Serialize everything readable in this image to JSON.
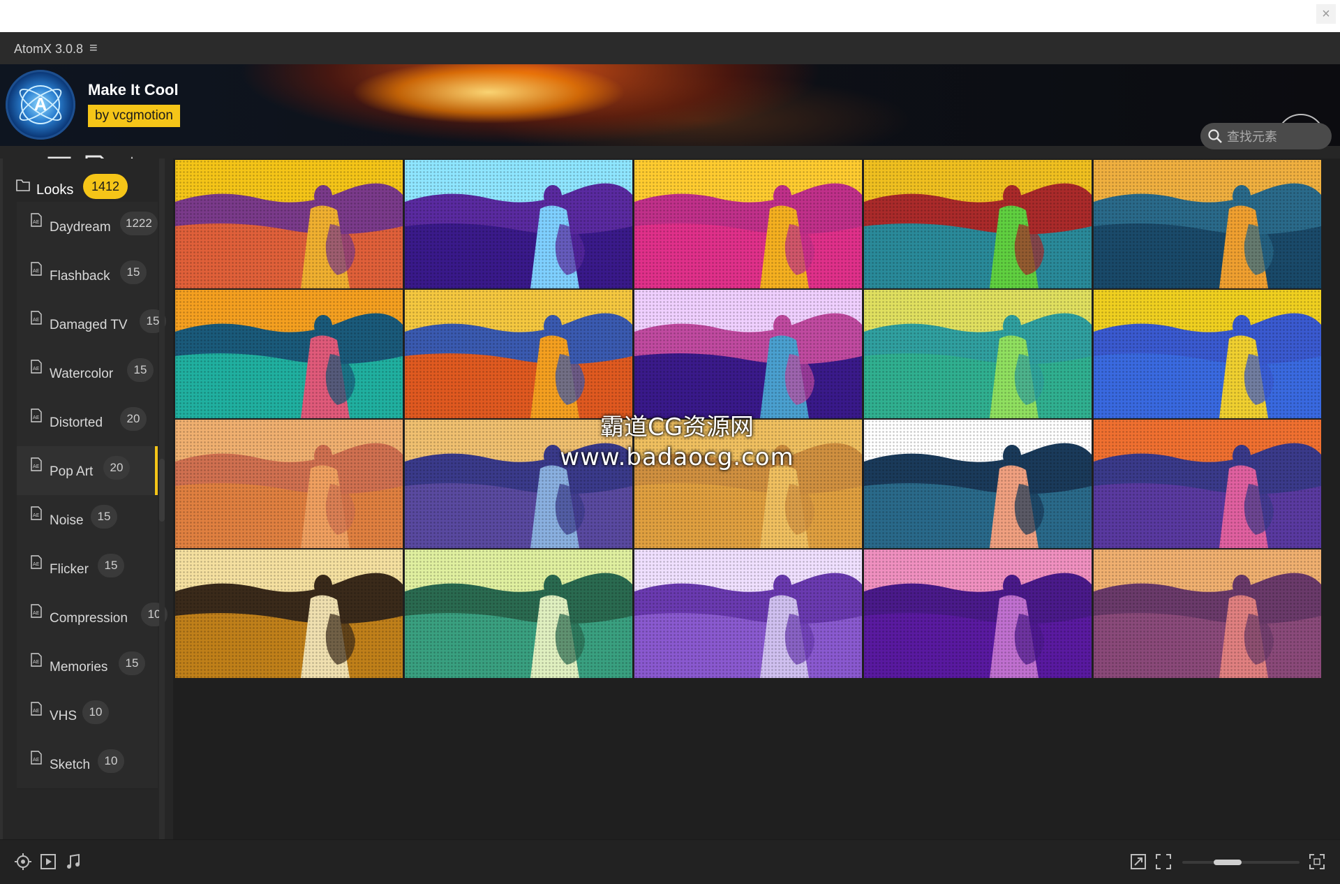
{
  "app": {
    "title": "AtomX 3.0.8",
    "menu_icon": "hamburger-icon"
  },
  "banner": {
    "logo_letter": "A",
    "preset_name": "Make It Cool",
    "author": "by vcgmotion",
    "store_icon": "shopping-bag-icon"
  },
  "toolbar": {
    "tools": [
      "sliders-icon",
      "list-icon",
      "video-file-icon",
      "star-icon"
    ]
  },
  "search": {
    "placeholder": "查找元素"
  },
  "sidebar": {
    "root": {
      "label": "Looks",
      "count": "1412"
    },
    "categories": [
      {
        "label": "Daydream",
        "count": "1222"
      },
      {
        "label": "Flashback",
        "count": "15"
      },
      {
        "label": "Damaged TV",
        "count": "15"
      },
      {
        "label": "Watercolor",
        "count": "15"
      },
      {
        "label": "Distorted",
        "count": "20"
      },
      {
        "label": "Pop Art",
        "count": "20",
        "active": true
      },
      {
        "label": "Noise",
        "count": "15"
      },
      {
        "label": "Flicker",
        "count": "15"
      },
      {
        "label": "Compression",
        "count": "10"
      },
      {
        "label": "Memories",
        "count": "15"
      },
      {
        "label": "VHS",
        "count": "10"
      },
      {
        "label": "Sketch",
        "count": "10"
      }
    ]
  },
  "grid": {
    "thumbnails": [
      {
        "sky": "#f5c518",
        "land": "#e0603a",
        "figure": "#f0b030",
        "hill": "#7a3a8a"
      },
      {
        "sky": "#8fe6ff",
        "land": "#3a1a8a",
        "figure": "#7fd0ff",
        "hill": "#5a2aa0"
      },
      {
        "sky": "#ffcc30",
        "land": "#e0308a",
        "figure": "#f5b020",
        "hill": "#c0308a"
      },
      {
        "sky": "#f0c020",
        "land": "#2a8a9a",
        "figure": "#60d040",
        "hill": "#aa2a2a"
      },
      {
        "sky": "#f0b040",
        "land": "#1a4a6a",
        "figure": "#f0a030",
        "hill": "#2a6a8a"
      },
      {
        "sky": "#f5a020",
        "land": "#20b0a0",
        "figure": "#e05a7a",
        "hill": "#1a5a7a"
      },
      {
        "sky": "#f5c840",
        "land": "#e05a20",
        "figure": "#f5a020",
        "hill": "#3a5ab0"
      },
      {
        "sky": "#f0d0ff",
        "land": "#3a1a8a",
        "figure": "#4aa0d0",
        "hill": "#c04aa0"
      },
      {
        "sky": "#e0e060",
        "land": "#30b090",
        "figure": "#90e060",
        "hill": "#30a0a0"
      },
      {
        "sky": "#f0d020",
        "land": "#3a6ae0",
        "figure": "#f0d030",
        "hill": "#3a5ad0"
      },
      {
        "sky": "#f0b070",
        "land": "#e08040",
        "figure": "#f0a060",
        "hill": "#d07050"
      },
      {
        "sky": "#f0c070",
        "land": "#5a4aa0",
        "figure": "#8ab0e0",
        "hill": "#3a3a8a"
      },
      {
        "sky": "#f0c060",
        "land": "#e0a040",
        "figure": "#f0c060",
        "hill": "#d09040"
      },
      {
        "sky": "#ffffff",
        "land": "#2a6a8a",
        "figure": "#f0a080",
        "hill": "#1a3a5a"
      },
      {
        "sky": "#f07030",
        "land": "#5a3aa0",
        "figure": "#e060a0",
        "hill": "#3a3a8a"
      },
      {
        "sky": "#f5e0a0",
        "land": "#c0801a",
        "figure": "#f0e0b0",
        "hill": "#3a2a1a"
      },
      {
        "sky": "#e0f0a0",
        "land": "#3aa080",
        "figure": "#e0f0c0",
        "hill": "#2a6a50"
      },
      {
        "sky": "#f0e0ff",
        "land": "#8a5ad0",
        "figure": "#d0c0f0",
        "hill": "#6a3ab0"
      },
      {
        "sky": "#f090c0",
        "land": "#5a1aa0",
        "figure": "#c070d0",
        "hill": "#4a1a8a"
      },
      {
        "sky": "#f0b070",
        "land": "#8a4a7a",
        "figure": "#e08080",
        "hill": "#6a3a6a"
      }
    ]
  },
  "watermark": {
    "line1": "霸道CG资源网",
    "line2": "www.badaocg.com"
  },
  "bottombar": {
    "left_icons": [
      "target-icon",
      "play-box-icon",
      "music-note-icon"
    ],
    "right_icons": [
      "expand-icon",
      "fit-icon",
      "fullscreen-icon"
    ],
    "zoom_level": 0.35
  }
}
